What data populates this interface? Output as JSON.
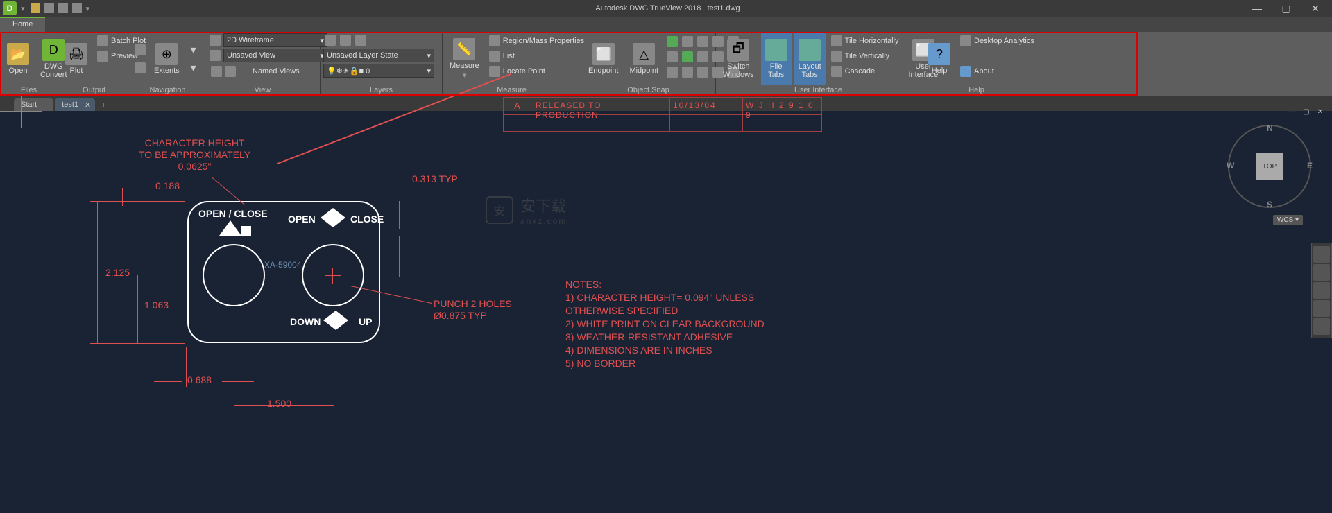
{
  "app": {
    "title": "Autodesk DWG TrueView 2018",
    "filename": "test1.dwg",
    "logo": "D"
  },
  "tabs": {
    "home": "Home"
  },
  "ribbon": {
    "files": {
      "title": "Files",
      "open": "Open",
      "convert": "DWG\nConvert"
    },
    "output": {
      "title": "Output",
      "plot": "Plot",
      "batch": "Batch Plot",
      "preview": "Preview"
    },
    "nav": {
      "title": "Navigation",
      "extents": "Extents"
    },
    "view": {
      "title": "View",
      "wireframe": "2D Wireframe",
      "unsaved": "Unsaved View",
      "named": "Named Views"
    },
    "layers": {
      "title": "Layers",
      "state": "Unsaved Layer State",
      "layer0": "0"
    },
    "measure": {
      "title": "Measure",
      "btn": "Measure",
      "region": "Region/Mass Properties",
      "list": "List",
      "locate": "Locate Point"
    },
    "osnap": {
      "title": "Object Snap",
      "endpoint": "Endpoint",
      "midpoint": "Midpoint"
    },
    "ui": {
      "title": "User Interface",
      "switch": "Switch\nWindows",
      "filetabs": "File Tabs",
      "layouttabs": "Layout\nTabs",
      "tileh": "Tile Horizontally",
      "tilev": "Tile Vertically",
      "cascade": "Cascade",
      "user": "User\nInterface"
    },
    "help": {
      "title": "Help",
      "help": "Help",
      "analytics": "Desktop Analytics",
      "about": "About"
    }
  },
  "doctabs": {
    "start": "Start",
    "file": "test1"
  },
  "drawing": {
    "char_note": "CHARACTER HEIGHT\nTO BE APPROXIMATELY\n0.0625\"",
    "dim_188": "0.188",
    "dim_313": "0.313 TYP",
    "dim_2125": "2.125",
    "dim_1063": "1.063",
    "dim_688": "0.688",
    "dim_1500": "1.500",
    "open_close": "OPEN / CLOSE",
    "open": "OPEN",
    "close": "CLOSE",
    "down": "DOWN",
    "up": "UP",
    "part": "XA-59004",
    "punch": "PUNCH 2 HOLES\nØ0.875 TYP",
    "release": "RELEASED TO PRODUCTION",
    "rev": "A",
    "date": "10/13/04",
    "by": "W J H 2 9 1 0 9",
    "notes_title": "NOTES:",
    "note1": "1) CHARACTER HEIGHT= 0.094\" UNLESS",
    "note1b": "OTHERWISE   SPECIFIED",
    "note2": "2) WHITE PRINT ON CLEAR BACKGROUND",
    "note3": "3) WEATHER-RESISTANT ADHESIVE",
    "note4": "4) DIMENSIONS ARE IN INCHES",
    "note5": "5) NO BORDER"
  },
  "viewcube": {
    "top": "TOP",
    "n": "N",
    "s": "S",
    "e": "E",
    "w": "W",
    "wcs": "WCS ▾"
  },
  "watermark": {
    "text": "安下载",
    "url": "anxz.com"
  }
}
